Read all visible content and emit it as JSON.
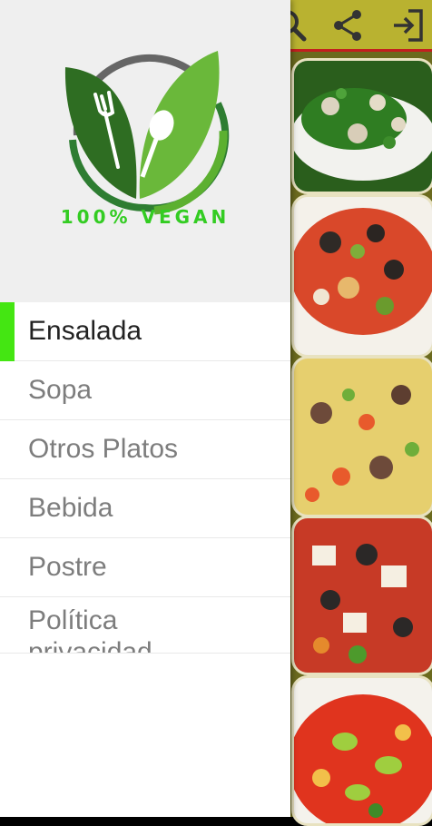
{
  "app": {
    "toolbar": {
      "icons": [
        "search-icon",
        "share-icon",
        "exit-icon"
      ],
      "accent": "#b9b230",
      "underline": "#c31f1f"
    },
    "food_images": [
      "salad-greens-image",
      "salad-olives-image",
      "couscous-salad-image",
      "greek-salad-image",
      "tomato-kiwi-salad-image"
    ]
  },
  "drawer": {
    "logo_text": "100% VEGAN",
    "menu": [
      {
        "label": "Ensalada",
        "active": true
      },
      {
        "label": "Sopa",
        "active": false
      },
      {
        "label": "Otros Platos",
        "active": false
      },
      {
        "label": "Bebida",
        "active": false
      },
      {
        "label": "Postre",
        "active": false
      },
      {
        "label": "Política privacidad",
        "active": false
      }
    ],
    "active_indicator_color": "#44e612"
  }
}
